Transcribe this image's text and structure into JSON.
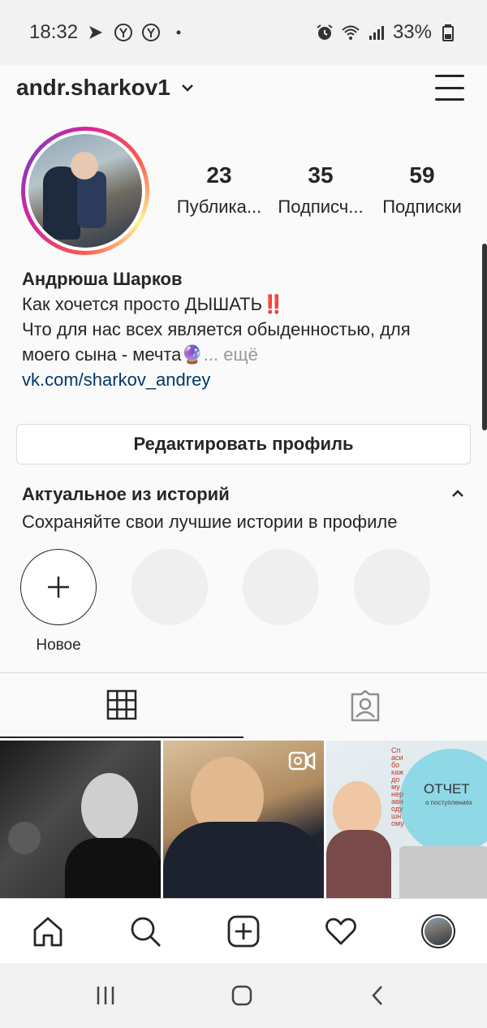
{
  "status_bar": {
    "time": "18:32",
    "battery": "33%",
    "icons": [
      "notification-icon",
      "yandex-icon",
      "yandex-icon",
      "dot-icon",
      "alarm-icon",
      "wifi-icon",
      "signal-icon",
      "battery-icon"
    ]
  },
  "header": {
    "username": "andr.sharkov1",
    "dropdown_icon": "chevron-down-icon",
    "menu_icon": "hamburger-menu-icon"
  },
  "stats": [
    {
      "num": "23",
      "label": "Публика..."
    },
    {
      "num": "35",
      "label": "Подписч..."
    },
    {
      "num": "59",
      "label": "Подписки"
    }
  ],
  "bio": {
    "name": "Андрюша Шарков",
    "line1": "Как хочется просто ДЫШАТЬ‼️",
    "line2": "Что для нас всех является обыденностью, для",
    "line3": "моего сына - мечта🔮",
    "more": "... ещё",
    "link": "vk.com/sharkov_andrey"
  },
  "edit_profile": "Редактировать профиль",
  "highlights": {
    "title": "Актуальное из историй",
    "subtitle": "Сохраняйте свои лучшие истории в профиле",
    "new_label": "Новое"
  },
  "posts": {
    "post3_caption": "ОТЧЕТ",
    "post3_subcaption": "о поступлениях",
    "post3_ribbon": "Спасибо каждому неравнодушному"
  },
  "colors": {
    "accent_link": "#00376b",
    "text": "#262626",
    "border": "#dbdbdb"
  }
}
